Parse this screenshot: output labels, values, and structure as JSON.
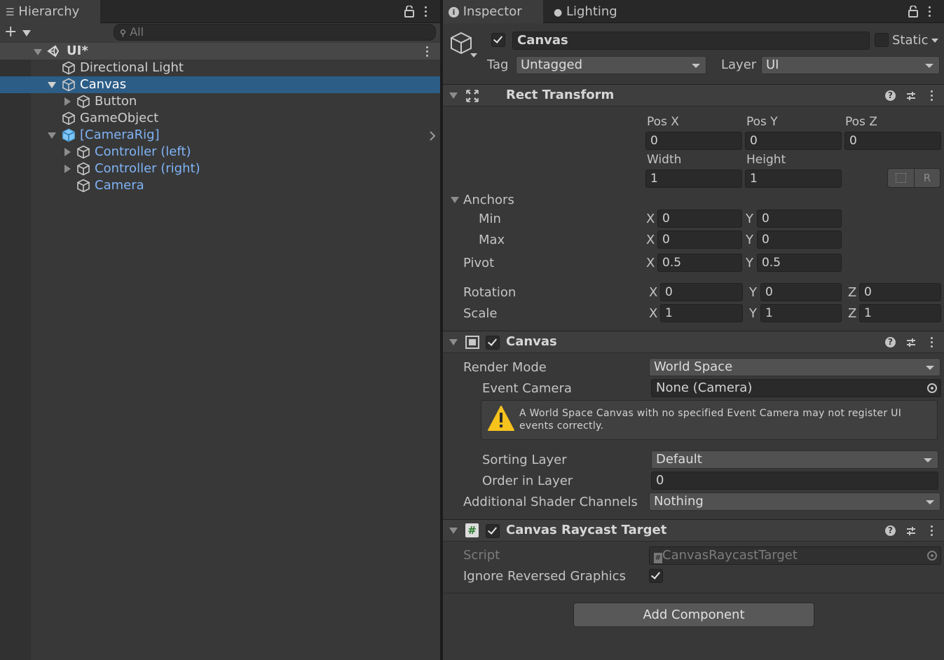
{
  "hierarchy": {
    "tab_label": "Hierarchy",
    "search_placeholder": "All",
    "scene_name": "UI*",
    "items": [
      {
        "label": "Directional Light",
        "prefab": false
      },
      {
        "label": "Canvas",
        "prefab": false,
        "selected": true
      },
      {
        "label": "Button",
        "prefab": false
      },
      {
        "label": "GameObject",
        "prefab": false
      },
      {
        "label": "[CameraRig]",
        "prefab": true
      },
      {
        "label": "Controller (left)",
        "prefab": true
      },
      {
        "label": "Controller (right)",
        "prefab": true
      },
      {
        "label": "Camera",
        "prefab": true
      }
    ]
  },
  "inspector": {
    "tabs": [
      "Inspector",
      "Lighting"
    ],
    "object_name": "Canvas",
    "static_label": "Static",
    "tag_label": "Tag",
    "tag_value": "Untagged",
    "layer_label": "Layer",
    "layer_value": "UI"
  },
  "rect_transform": {
    "title": "Rect Transform",
    "pos_x_label": "Pos X",
    "pos_x": "0",
    "pos_y_label": "Pos Y",
    "pos_y": "0",
    "pos_z_label": "Pos Z",
    "pos_z": "0",
    "width_label": "Width",
    "width": "1",
    "height_label": "Height",
    "height": "1",
    "raw_button": "R",
    "anchors_label": "Anchors",
    "min_label": "Min",
    "min_x": "0",
    "min_y": "0",
    "max_label": "Max",
    "max_x": "0",
    "max_y": "0",
    "pivot_label": "Pivot",
    "pivot_x": "0.5",
    "pivot_y": "0.5",
    "rotation_label": "Rotation",
    "rot_x": "0",
    "rot_y": "0",
    "rot_z": "0",
    "scale_label": "Scale",
    "scale_x": "1",
    "scale_y": "1",
    "scale_z": "1",
    "x": "X",
    "y": "Y",
    "z": "Z"
  },
  "canvas": {
    "title": "Canvas",
    "render_mode_label": "Render Mode",
    "render_mode": "World Space",
    "event_camera_label": "Event Camera",
    "event_camera": "None (Camera)",
    "warning": "A World Space Canvas with no specified Event Camera may not register UI events correctly.",
    "sorting_layer_label": "Sorting Layer",
    "sorting_layer": "Default",
    "order_label": "Order in Layer",
    "order": "0",
    "shader_label": "Additional Shader Channels",
    "shader": "Nothing"
  },
  "raycast": {
    "title": "Canvas Raycast Target",
    "script_label": "Script",
    "script": "CanvasRaycastTarget",
    "ignore_label": "Ignore Reversed Graphics"
  },
  "add_component": "Add Component",
  "colors": {
    "selection": "#2c5d87",
    "prefab_text": "#7fb3f5",
    "panel": "#383838"
  }
}
